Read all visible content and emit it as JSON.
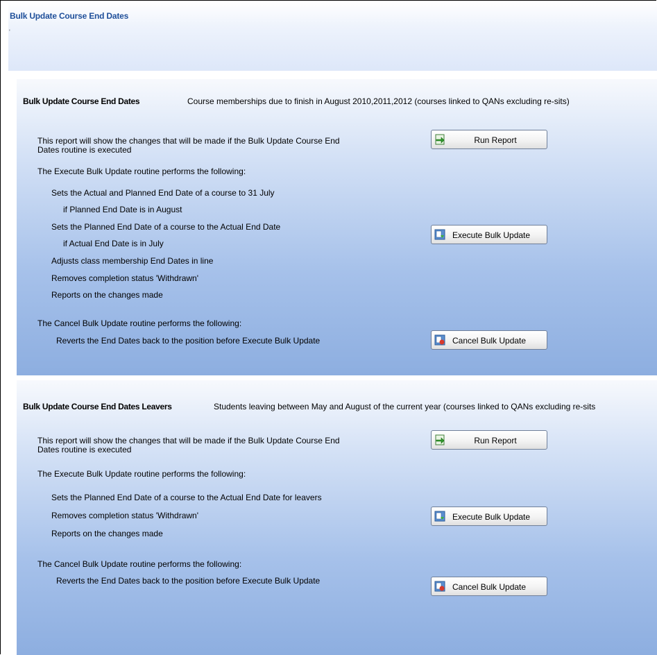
{
  "window": {
    "title": "Bulk Update Course End Dates"
  },
  "panel1": {
    "title": "Bulk Update Course End Dates",
    "description": "Course memberships due to finish in August 2010,2011,2012 (courses linked to QANs excluding re-sits)",
    "report_line1": "This report will show the changes that will be made if the Bulk Update Course End",
    "report_line2": "Dates routine is executed",
    "exec_heading": "The Execute Bulk Update routine performs the following:",
    "exec_item1": "Sets the Actual and Planned End Date of a course to 31 July",
    "exec_item1_sub": "if Planned End Date is in August",
    "exec_item2": "Sets the Planned End Date of a course to the Actual End Date",
    "exec_item2_sub": "if Actual End Date is in July",
    "exec_item3": "Adjusts class membership End Dates in line",
    "exec_item4": "Removes completion status 'Withdrawn'",
    "exec_item5": "Reports on the changes made",
    "cancel_heading": "The Cancel Bulk Update routine performs the following:",
    "cancel_item1": "Reverts the End Dates back to the position before Execute Bulk Update",
    "run_report_label": "Run Report",
    "execute_label": "Execute Bulk Update",
    "cancel_label": "Cancel Bulk Update"
  },
  "panel2": {
    "title": "Bulk Update Course End Dates Leavers",
    "description": "Students leaving between May and August of the current year (courses linked to QANs excluding re-sits",
    "report_line1": "This report will show the changes that will be made if the Bulk Update Course End",
    "report_line2": "Dates routine is executed",
    "exec_heading": "The  Execute Bulk Update routine performs the following:",
    "exec_item1": "Sets the Planned End Date of a course to the Actual End Date for leavers",
    "exec_item2": "Removes completion status 'Withdrawn'",
    "exec_item3": "Reports on the changes made",
    "cancel_heading": "The Cancel Bulk Update routine performs the following:",
    "cancel_item1": "Reverts the End Dates back to the position before Execute Bulk Update",
    "run_report_label": "Run Report",
    "execute_label": "Execute Bulk Update",
    "cancel_label": "Cancel Bulk Update"
  },
  "icons": {
    "run_report": "report-arrow-icon",
    "execute": "execute-update-icon",
    "cancel": "cancel-update-icon"
  }
}
